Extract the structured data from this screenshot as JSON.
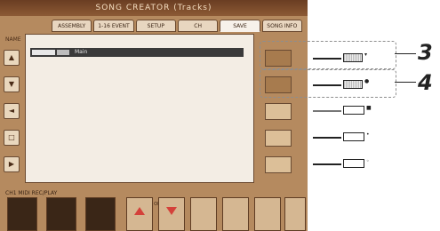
{
  "screen": {
    "title": "SONG CREATOR (Tracks)",
    "tabs": [
      "ASSEMBLY",
      "1-16 EVENT",
      "SETUP",
      "CH",
      "SAVE",
      "SONG INFO"
    ],
    "active_tab_index": 4,
    "list_header": "NAME",
    "row_text": "Main",
    "bottom_labels": "CH1  MIDI  REC/PLAY",
    "sub_label": "ALL OFF / ON"
  },
  "annotations": {
    "callout_3": "3",
    "callout_4": "4"
  },
  "colors": {
    "screen_bg": "#b58a5f",
    "panel_bg": "#f3ede4",
    "selected_row": "#3a3a3a",
    "red_arrow": "#d4413a"
  },
  "icons": {
    "left_column": [
      "scroll-up-icon",
      "scroll-down-icon",
      "left-arrow-icon",
      "page-icon",
      "triangle-icon"
    ],
    "bottom_arrows": [
      "red-up-arrow-icon",
      "red-down-arrow-icon"
    ]
  }
}
